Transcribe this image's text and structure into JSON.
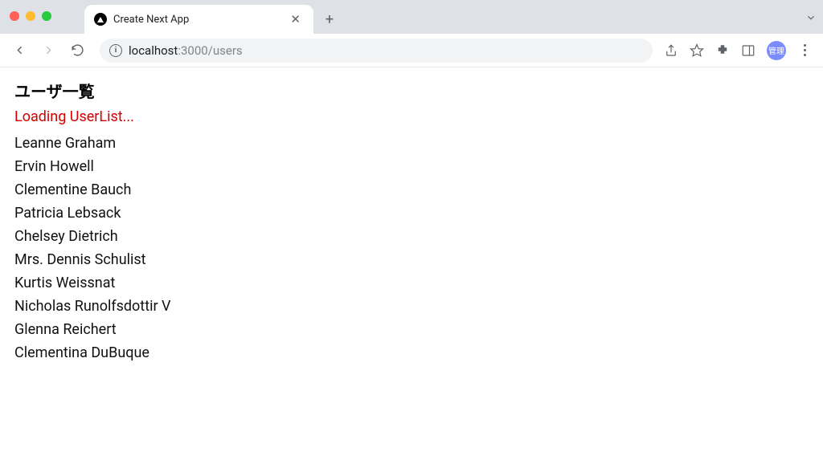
{
  "browser": {
    "tab_title": "Create Next App",
    "url_host": "localhost",
    "url_port_path": ":3000/users"
  },
  "toolbar_icons": {
    "back": "back",
    "forward": "forward",
    "reload": "reload",
    "share": "share",
    "star": "star",
    "extensions": "extensions",
    "panel": "panel",
    "avatar_label": "管理",
    "menu": "menu"
  },
  "content": {
    "heading": "ユーザ一覧",
    "loading_text": "Loading UserList...",
    "users": [
      "Leanne Graham",
      "Ervin Howell",
      "Clementine Bauch",
      "Patricia Lebsack",
      "Chelsey Dietrich",
      "Mrs. Dennis Schulist",
      "Kurtis Weissnat",
      "Nicholas Runolfsdottir V",
      "Glenna Reichert",
      "Clementina DuBuque"
    ]
  }
}
